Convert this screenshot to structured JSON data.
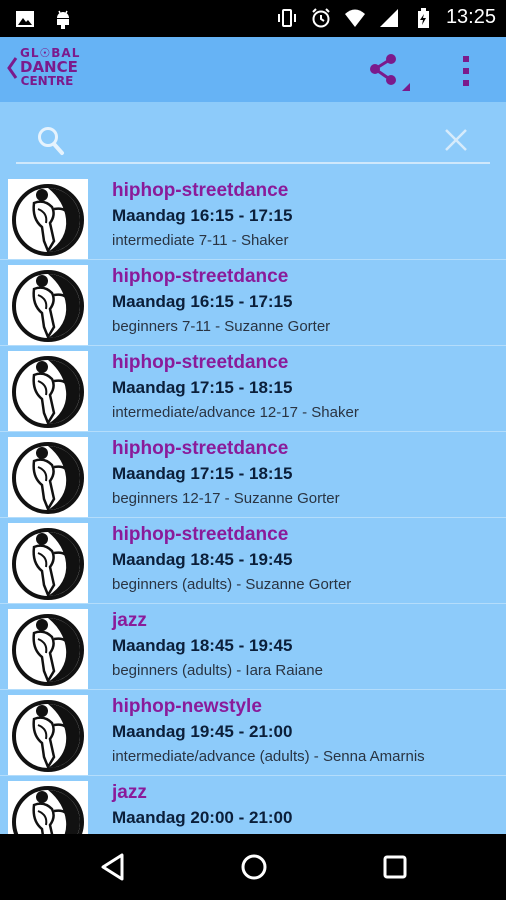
{
  "status_bar": {
    "time": "13:25",
    "icons": [
      "image-icon",
      "android-icon",
      "vibrate-icon",
      "alarm-icon",
      "wifi-icon",
      "signal-icon",
      "battery-charging-icon"
    ]
  },
  "app_bar": {
    "logo": {
      "line1": "GL☉BAL",
      "line2": "DANCE",
      "line3": "CENTRE"
    },
    "icons": [
      "back-chevron-icon",
      "share-icon",
      "overflow-menu-icon"
    ],
    "accent_color": "#7b1a8c"
  },
  "search": {
    "value": "",
    "placeholder": ""
  },
  "classes": [
    {
      "title": "hiphop-streetdance",
      "time": "Maandag 16:15 - 17:15",
      "detail": "intermediate 7-11 - Shaker"
    },
    {
      "title": "hiphop-streetdance",
      "time": "Maandag 16:15 - 17:15",
      "detail": "beginners 7-11 - Suzanne Gorter"
    },
    {
      "title": "hiphop-streetdance",
      "time": "Maandag 17:15 - 18:15",
      "detail": "intermediate/advance 12-17 - Shaker"
    },
    {
      "title": "hiphop-streetdance",
      "time": "Maandag 17:15 - 18:15",
      "detail": "beginners 12-17 - Suzanne Gorter"
    },
    {
      "title": "hiphop-streetdance",
      "time": "Maandag 18:45 - 19:45",
      "detail": "beginners (adults) - Suzanne Gorter"
    },
    {
      "title": "jazz",
      "time": "Maandag 18:45 - 19:45",
      "detail": "beginners (adults) - Iara Raiane"
    },
    {
      "title": "hiphop-newstyle",
      "time": "Maandag 19:45 - 21:00",
      "detail": "intermediate/advance (adults) - Senna Amarnis"
    },
    {
      "title": "jazz",
      "time": "Maandag 20:00 - 21:00",
      "detail": ""
    }
  ],
  "colors": {
    "app_bar": "#66b3f5",
    "list_background": "#8dcbfa",
    "title": "#8a1b9a",
    "time": "#0b1f3a"
  },
  "nav_bar": {
    "icons": [
      "back-triangle-icon",
      "home-circle-icon",
      "recents-square-icon"
    ]
  }
}
